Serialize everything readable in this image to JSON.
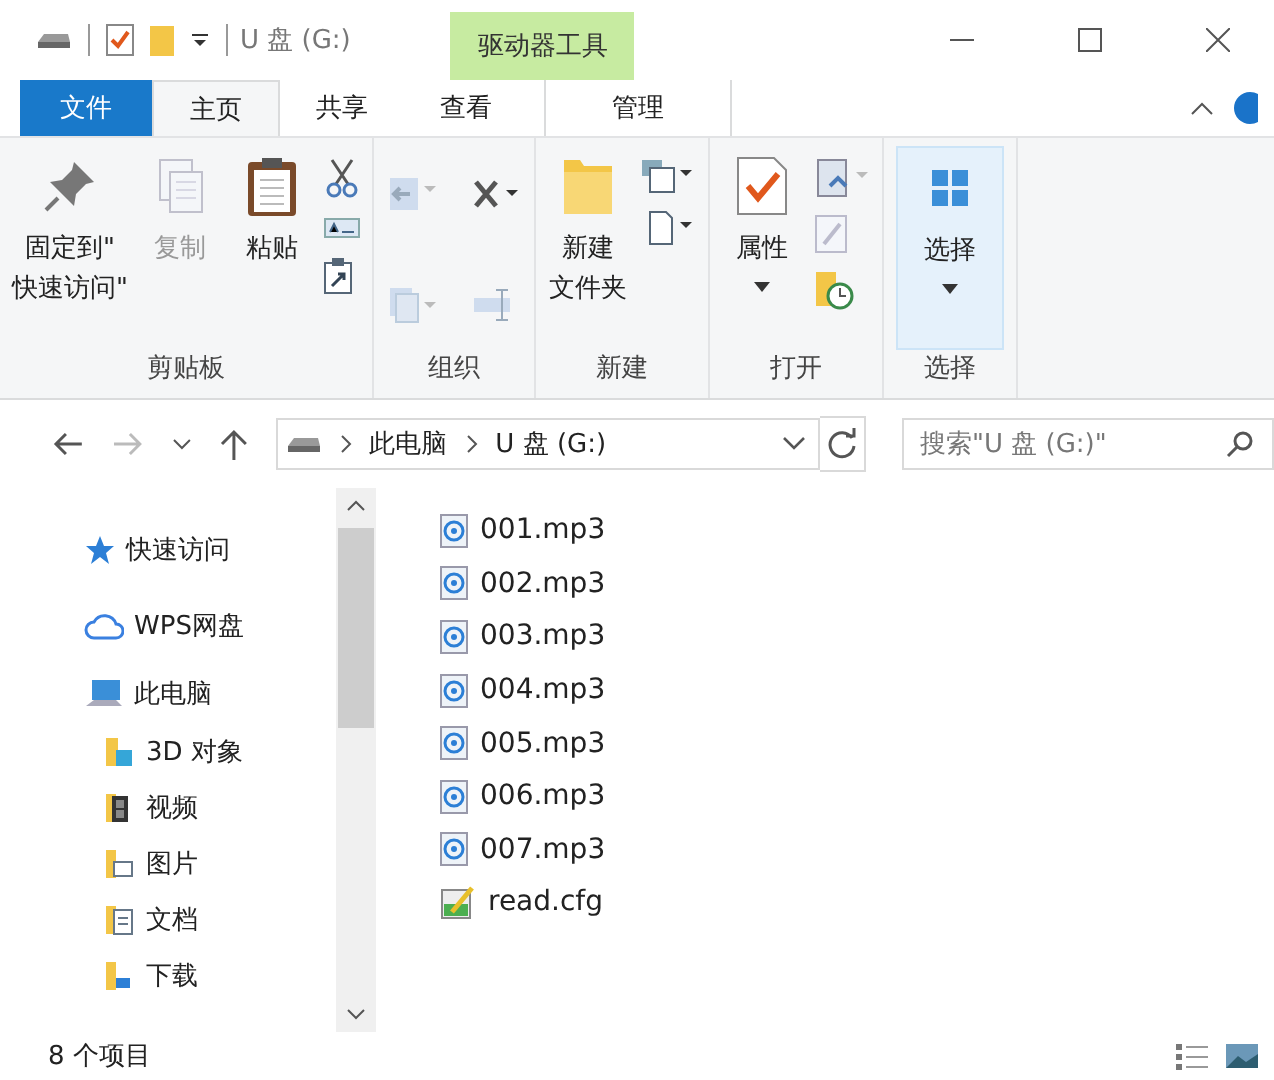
{
  "window": {
    "title": "U 盘 (G:)",
    "context_tab_group": "驱动器工具"
  },
  "tabs": [
    {
      "label": "文件",
      "kind": "file",
      "selected": false
    },
    {
      "label": "主页",
      "kind": "tab",
      "selected": true
    },
    {
      "label": "共享",
      "kind": "tab",
      "selected": false
    },
    {
      "label": "查看",
      "kind": "tab",
      "selected": false
    },
    {
      "label": "管理",
      "kind": "context",
      "selected": false
    }
  ],
  "ribbon": {
    "groups": [
      {
        "label": "剪贴板",
        "buttons": [
          {
            "kind": "pin",
            "lines": [
              "固定到\"",
              "快速访问\""
            ],
            "disabled": false
          },
          {
            "kind": "copy",
            "lines": [
              "复制"
            ],
            "disabled": true
          },
          {
            "kind": "paste",
            "lines": [
              "粘贴"
            ],
            "disabled": false
          }
        ]
      },
      {
        "label": "组织"
      },
      {
        "label": "新建",
        "buttons": [
          {
            "kind": "folder",
            "lines": [
              "新建",
              "文件夹"
            ],
            "disabled": false
          }
        ]
      },
      {
        "label": "打开",
        "buttons": [
          {
            "kind": "properties",
            "lines": [
              "属性"
            ],
            "disabled": false,
            "dropdown": true
          }
        ]
      },
      {
        "label": "选择",
        "buttons": [
          {
            "kind": "select",
            "lines": [
              "选择"
            ],
            "disabled": false,
            "dropdown": true
          }
        ]
      }
    ]
  },
  "address": {
    "path": [
      "此电脑",
      "U 盘 (G:)"
    ],
    "search_placeholder": "搜索\"U 盘 (G:)\""
  },
  "nav": [
    {
      "label": "快速访问",
      "kind": "quick"
    },
    {
      "label": "WPS网盘",
      "kind": "cloud"
    },
    {
      "label": "此电脑",
      "kind": "computer",
      "children": [
        {
          "label": "3D 对象",
          "kind": "objects"
        },
        {
          "label": "视频",
          "kind": "videos"
        },
        {
          "label": "图片",
          "kind": "pictures"
        },
        {
          "label": "文档",
          "kind": "documents"
        },
        {
          "label": "下载",
          "kind": "downloads"
        }
      ]
    }
  ],
  "files": [
    {
      "name": "001.mp3",
      "kind": "audio"
    },
    {
      "name": "002.mp3",
      "kind": "audio"
    },
    {
      "name": "003.mp3",
      "kind": "audio"
    },
    {
      "name": "004.mp3",
      "kind": "audio"
    },
    {
      "name": "005.mp3",
      "kind": "audio"
    },
    {
      "name": "006.mp3",
      "kind": "audio"
    },
    {
      "name": "007.mp3",
      "kind": "audio"
    },
    {
      "name": "read.cfg",
      "kind": "config"
    }
  ],
  "status_bar": {
    "count": "8 个项目"
  }
}
